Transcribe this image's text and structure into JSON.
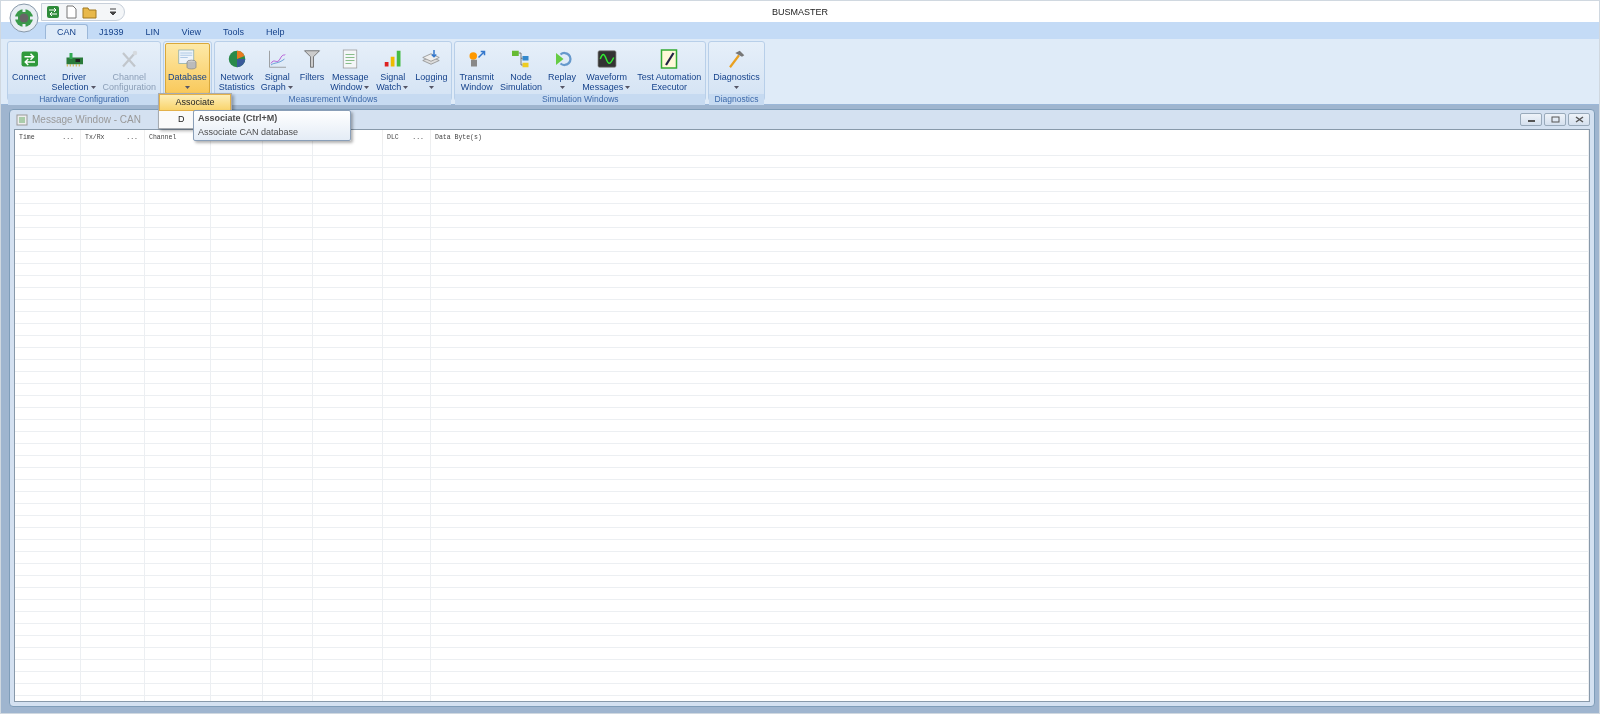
{
  "window": {
    "title": "BUSMASTER"
  },
  "tabs": [
    {
      "label": "CAN",
      "selected": true
    },
    {
      "label": "J1939",
      "selected": false
    },
    {
      "label": "LIN",
      "selected": false
    },
    {
      "label": "View",
      "selected": false
    },
    {
      "label": "Tools",
      "selected": false
    },
    {
      "label": "Help",
      "selected": false
    }
  ],
  "ribbon_groups": [
    {
      "label": "Hardware Configuration",
      "buttons": [
        {
          "label": "Connect",
          "dropdown": false,
          "disabled": false,
          "selected": false
        },
        {
          "label": "Driver\nSelection",
          "dropdown": true,
          "disabled": false,
          "selected": false
        },
        {
          "label": "Channel\nConfiguration",
          "dropdown": false,
          "disabled": true,
          "selected": false
        }
      ]
    },
    {
      "buttons": [
        {
          "label": "Database",
          "dropdown": true,
          "disabled": false,
          "selected": true
        }
      ]
    },
    {
      "label": "Measurement Windows",
      "buttons": [
        {
          "label": "Network\nStatistics",
          "dropdown": false,
          "disabled": false,
          "selected": false
        },
        {
          "label": "Signal\nGraph",
          "dropdown": true,
          "disabled": false,
          "selected": false
        },
        {
          "label": "Filters",
          "dropdown": false,
          "disabled": false,
          "selected": false
        },
        {
          "label": "Message\nWindow",
          "dropdown": true,
          "disabled": false,
          "selected": false
        },
        {
          "label": "Signal\nWatch",
          "dropdown": true,
          "disabled": false,
          "selected": false
        },
        {
          "label": "Logging",
          "dropdown": true,
          "disabled": false,
          "selected": false
        }
      ]
    },
    {
      "label": "Simulation Windows",
      "buttons": [
        {
          "label": "Transmit\nWindow",
          "dropdown": false,
          "disabled": false,
          "selected": false
        },
        {
          "label": "Node\nSimulation",
          "dropdown": false,
          "disabled": false,
          "selected": false
        },
        {
          "label": "Replay",
          "dropdown": true,
          "disabled": false,
          "selected": false
        },
        {
          "label": "Waveform\nMessages",
          "dropdown": true,
          "disabled": false,
          "selected": false
        },
        {
          "label": "Test Automation\nExecutor",
          "dropdown": false,
          "disabled": false,
          "selected": false
        }
      ]
    },
    {
      "label": "Diagnostics",
      "buttons": [
        {
          "label": "Diagnostics",
          "dropdown": true,
          "disabled": false,
          "selected": false
        }
      ]
    }
  ],
  "database_menu": {
    "items": [
      {
        "label": "Associate",
        "selected": true
      },
      {
        "label": "D",
        "selected": false
      }
    ]
  },
  "tooltip": {
    "title": "Associate (Ctrl+M)",
    "text": "Associate CAN database"
  },
  "message_window": {
    "title": "Message Window - CAN",
    "columns": [
      {
        "label": "Time",
        "more": "..."
      },
      {
        "label": "Tx/Rx",
        "more": "..."
      },
      {
        "label": "Channel"
      },
      {},
      {},
      {},
      {
        "label": "DLC",
        "more": "..."
      },
      {
        "label": "Data Byte(s)"
      }
    ]
  }
}
